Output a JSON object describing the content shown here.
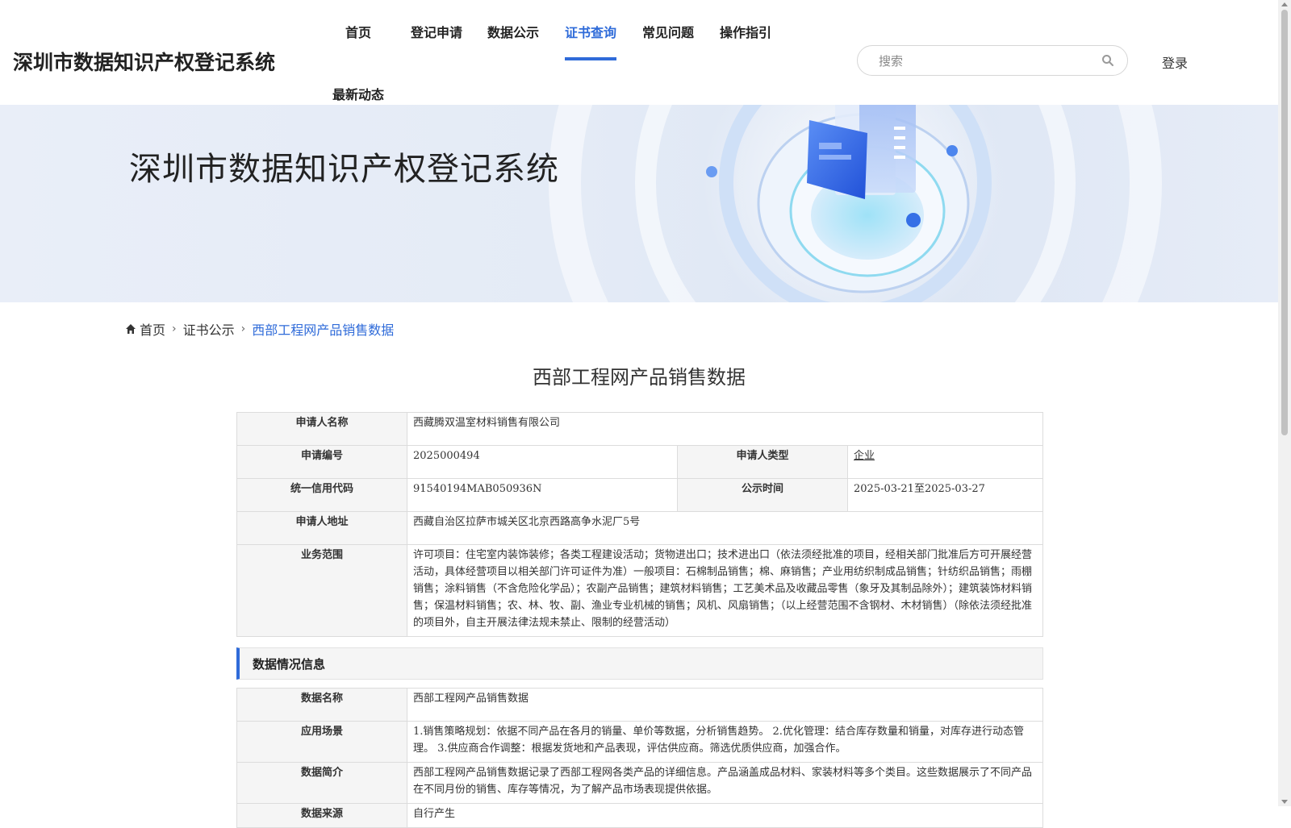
{
  "header": {
    "site_title": "深圳市数据知识产权登记系统",
    "nav": [
      {
        "label": "首页"
      },
      {
        "label": "登记申请"
      },
      {
        "label": "数据公示"
      },
      {
        "label": "证书查询",
        "active": true
      },
      {
        "label": "常见问题"
      },
      {
        "label": "操作指引"
      },
      {
        "label": "最新动态"
      }
    ],
    "search_placeholder": "搜索",
    "login_label": "登录"
  },
  "banner": {
    "title": "深圳市数据知识产权登记系统"
  },
  "breadcrumb": {
    "home": "首页",
    "level1": "证书公示",
    "current": "西部工程网产品销售数据"
  },
  "page_title": "西部工程网产品销售数据",
  "applicant": {
    "name_label": "申请人名称",
    "name": "西藏腾双温室材料销售有限公司",
    "app_no_label": "申请编号",
    "app_no": "2025000494",
    "type_label": "申请人类型",
    "type": "企业",
    "credit_code_label": "统一信用代码",
    "credit_code": "91540194MAB050936N",
    "publish_time_label": "公示时间",
    "publish_time": "2025-03-21至2025-03-27",
    "address_label": "申请人地址",
    "address": "西藏自治区拉萨市城关区北京西路高争水泥厂5号",
    "scope_label": "业务范围",
    "scope": "许可项目：住宅室内装饰装修；各类工程建设活动；货物进出口；技术进出口（依法须经批准的项目，经相关部门批准后方可开展经营活动，具体经营项目以相关部门许可证件为准）一般项目：石棉制品销售；棉、麻销售；产业用纺织制成品销售；针纺织品销售；雨棚销售；涂料销售（不含危险化学品）；农副产品销售；建筑材料销售；工艺美术品及收藏品零售（象牙及其制品除外）；建筑装饰材料销售；保温材料销售；农、林、牧、副、渔业专业机械的销售；风机、风扇销售；（以上经营范围不含钢材、木材销售）（除依法须经批准的项目外，自主开展法律法规未禁止、限制的经营活动）"
  },
  "data_section": {
    "header": "数据情况信息",
    "name_label": "数据名称",
    "name": "西部工程网产品销售数据",
    "scenario_label": "应用场景",
    "scenario": "1.销售策略规划：依据不同产品在各月的销量、单价等数据，分析销售趋势。 2.优化管理：结合库存数量和销量，对库存进行动态管理。 3.供应商合作调整：根据发货地和产品表现，评估供应商。筛选优质供应商，加强合作。",
    "intro_label": "数据简介",
    "intro": "西部工程网产品销售数据记录了西部工程网各类产品的详细信息。产品涵盖成品材料、家装材料等多个类目。这些数据展示了不同产品在不同月份的销售、库存等情况，为了解产品市场表现提供依据。",
    "source_label": "数据来源",
    "source": "自行产生"
  },
  "colors": {
    "accent": "#2f6bd9",
    "label_bg": "#f5f5f5",
    "border": "#dcdcdc"
  }
}
